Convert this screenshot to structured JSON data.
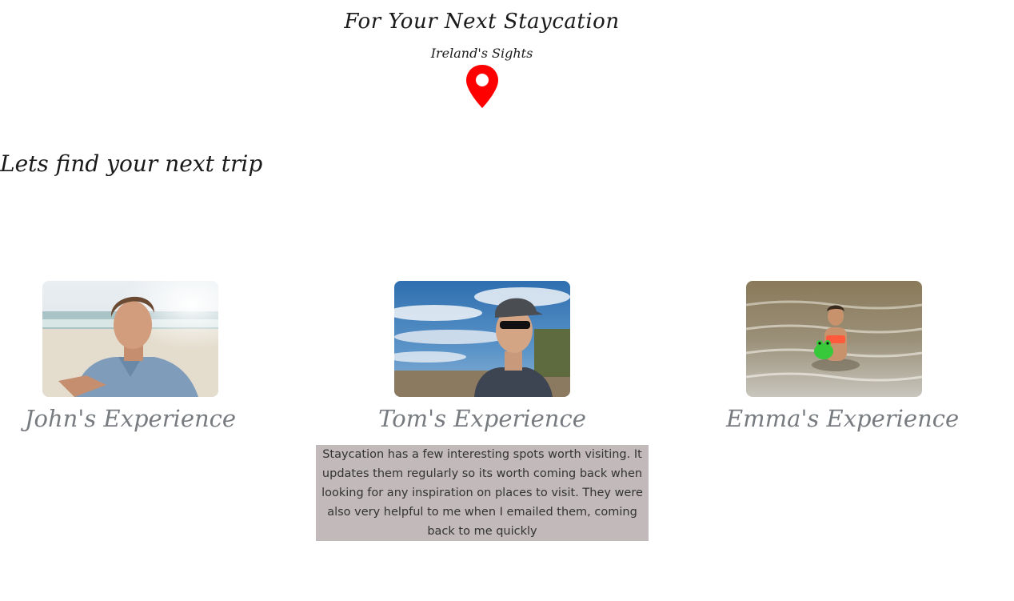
{
  "header": {
    "title": "For Your Next Staycation",
    "subtitle": "Ireland's Sights",
    "icon": "map-pin-icon",
    "accent_color": "#ff0000"
  },
  "main": {
    "tagline": "Lets find your next trip"
  },
  "testimonials": [
    {
      "name": "John's Experience"
    },
    {
      "name": "Tom's Experience"
    },
    {
      "name": "Emma's Experience"
    }
  ],
  "review": {
    "text": "Staycation has a few interesting spots worth visiting. It updates them regularly so its worth coming back when looking for any inspiration on places to visit. They were also very helpful to me when I emailed them, coming back to me quickly",
    "background_color": "#c1b9ba"
  },
  "colors": {
    "heading": "#1a1a1a",
    "card_name": "#777b80"
  }
}
